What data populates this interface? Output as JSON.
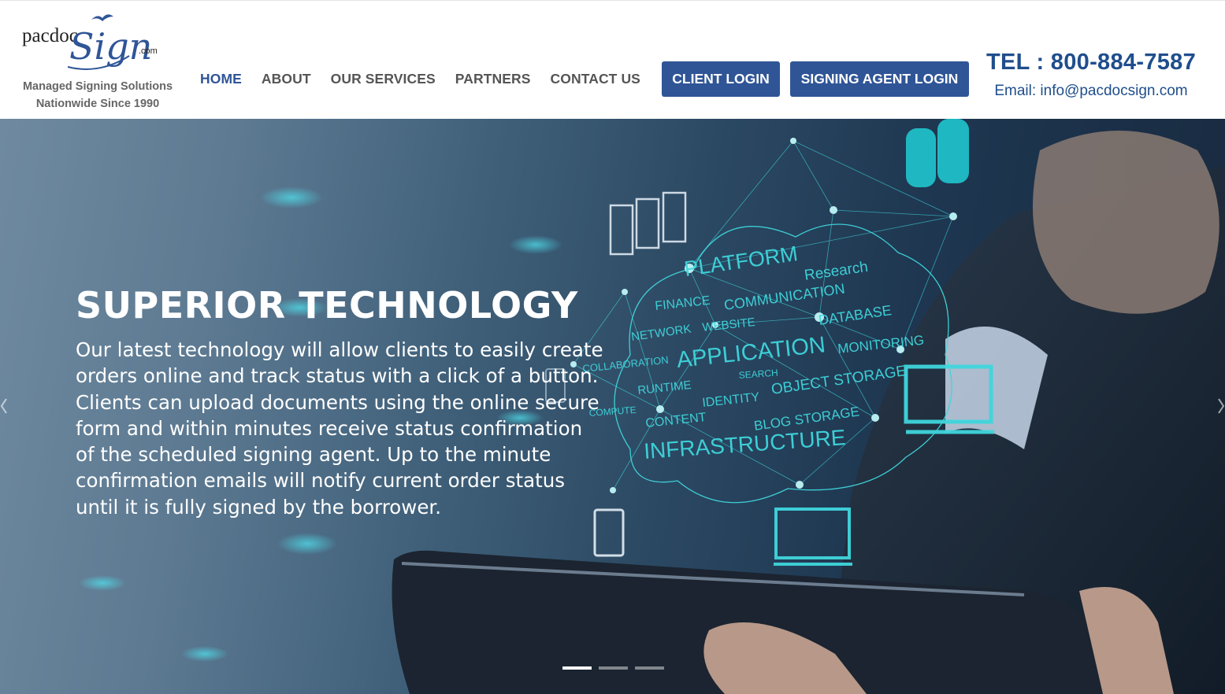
{
  "logo": {
    "wordmark_left": "pacdoc",
    "wordmark_script": "Sign",
    "wordmark_suffix": ".com",
    "tagline_line1": "Managed Signing Solutions",
    "tagline_line2": "Nationwide Since 1990",
    "icon": "bird-icon"
  },
  "nav": {
    "items": [
      {
        "label": "HOME",
        "active": true
      },
      {
        "label": "ABOUT",
        "active": false
      },
      {
        "label": "OUR SERVICES",
        "active": false
      },
      {
        "label": "PARTNERS",
        "active": false
      },
      {
        "label": "CONTACT US",
        "active": false
      }
    ]
  },
  "buttons": {
    "client_login": "CLIENT LOGIN",
    "signing_agent_login": "SIGNING AGENT LOGIN"
  },
  "contact": {
    "tel": "TEL : 800-884-7587",
    "email": "Email: info@pacdocsign.com"
  },
  "hero": {
    "title": "SUPERIOR TECHNOLOGY",
    "body_lines": [
      "Our latest technology will allow clients to easily create",
      "orders online and track status with a click of a button.",
      "Clients can upload documents using the online secure",
      "form and within minutes receive status confirmation",
      "of the scheduled signing agent. Up to the minute",
      "confirmation emails will notify current order status",
      "until it is fully signed by the borrower."
    ],
    "cloud_words": [
      "PLATFORM",
      "Research",
      "FINANCE",
      "COMMUNICATION",
      "NETWORK",
      "WEBSITE",
      "DATABASE",
      "APPLICATION",
      "MONITORING",
      "COLLABORATION",
      "SEARCH",
      "RUNTIME",
      "IDENTITY",
      "OBJECT STORAGE",
      "COMPUTE",
      "CONTENT",
      "BLOG STORAGE",
      "INFRASTRUCTURE"
    ],
    "slides_total": 3,
    "active_slide": 1
  },
  "colors": {
    "brand_blue": "#2f5597",
    "nav_text": "#555555",
    "contact_blue": "#1f4e8c",
    "cloud_cyan": "#3fd6dc"
  }
}
